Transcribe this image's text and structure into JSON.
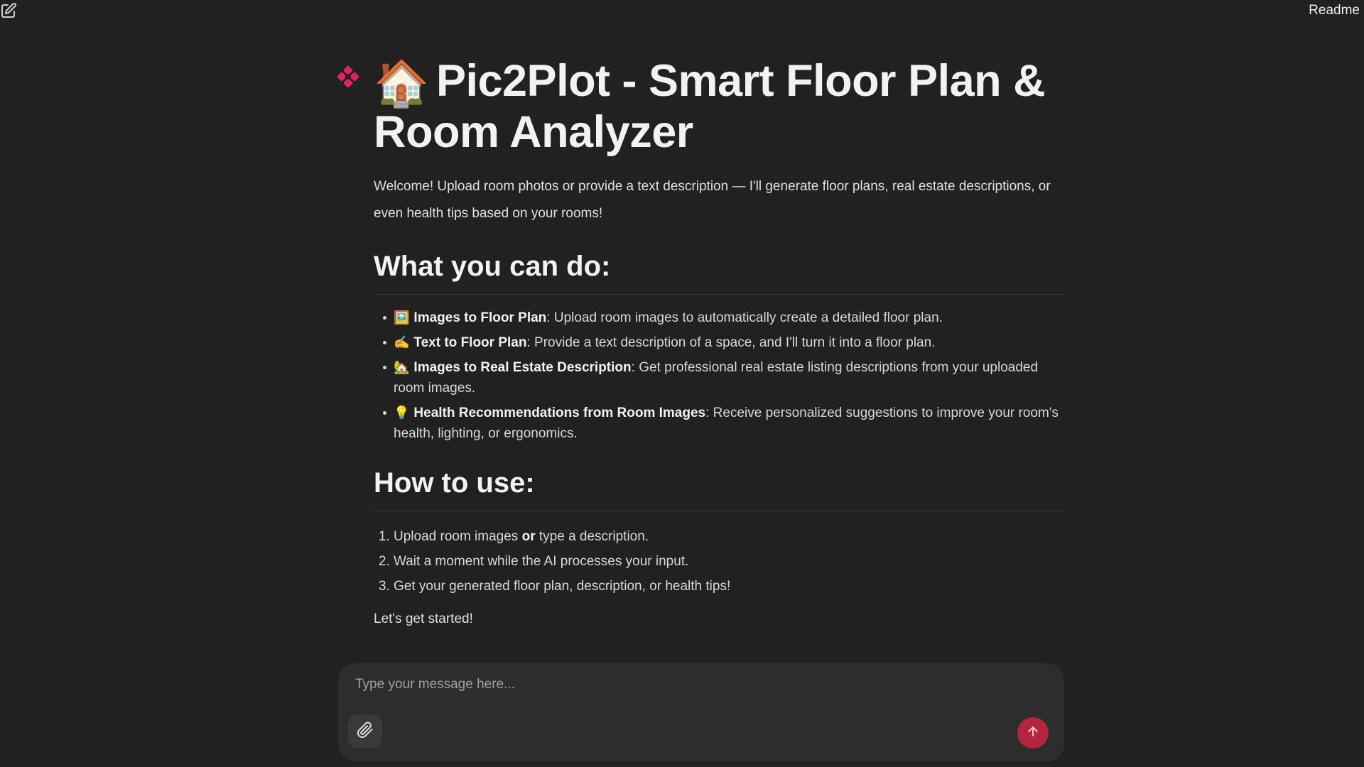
{
  "header": {
    "readme_label": "Readme",
    "new_chat_icon": "edit-icon"
  },
  "message": {
    "title": "Pic2Plot - Smart Floor Plan & Room Analyzer",
    "title_emoji": "🏠",
    "welcome": "Welcome! Upload room photos or provide a text description — I'll generate floor plans, real estate descriptions, or even health tips based on your rooms!",
    "section1_heading": "What you can do:",
    "features": [
      {
        "emoji": "🖼️",
        "title": "Images to Floor Plan",
        "text": ": Upload room images to automatically create a detailed floor plan."
      },
      {
        "emoji": "✍️",
        "title": "Text to Floor Plan",
        "text": ": Provide a text description of a space, and I'll turn it into a floor plan."
      },
      {
        "emoji": "🏡",
        "title": "Images to Real Estate Description",
        "text": ": Get professional real estate listing descriptions from your uploaded room images."
      },
      {
        "emoji": "💡",
        "title": "Health Recommendations from Room Images",
        "text": ": Receive personalized suggestions to improve your room's health, lighting, or ergonomics."
      }
    ],
    "section2_heading": "How to use:",
    "steps": {
      "step1_before": "Upload room images ",
      "step1_bold": "or",
      "step1_after": " type a description.",
      "step2": "Wait a moment while the AI processes your input.",
      "step3": "Get your generated floor plan, description, or health tips!"
    },
    "closing": "Let's get started!"
  },
  "composer": {
    "placeholder": "Type your message here...",
    "value": "",
    "attach_icon": "paperclip-icon",
    "send_icon": "arrow-up-icon"
  },
  "colors": {
    "background": "#212121",
    "composer_bg": "#2d2d2d",
    "accent": "#b4253f",
    "avatar": "#e0245e"
  }
}
